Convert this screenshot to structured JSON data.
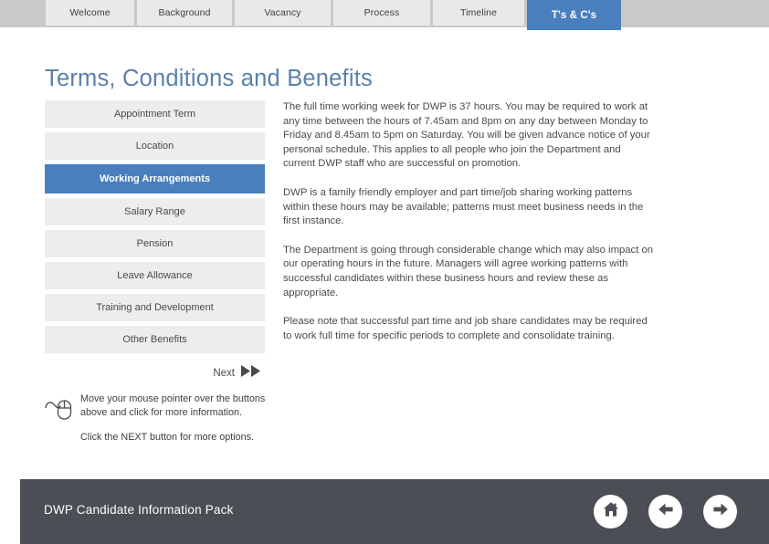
{
  "topbar": {
    "tabs": [
      {
        "label": "Welcome",
        "active": false
      },
      {
        "label": "Background",
        "active": false
      },
      {
        "label": "Vacancy",
        "active": false
      },
      {
        "label": "Process",
        "active": false
      },
      {
        "label": "Timeline",
        "active": false
      },
      {
        "label": "T's & C's",
        "active": true
      }
    ],
    "band_color": "#c9c9c9",
    "active_color": "#4a7fbd"
  },
  "page": {
    "title": "Terms, Conditions and Benefits",
    "title_color": "#5981ad"
  },
  "menu": {
    "items": [
      {
        "label": "Appointment Term",
        "selected": false
      },
      {
        "label": "Location",
        "selected": false
      },
      {
        "label": "Working Arrangements",
        "selected": true
      },
      {
        "label": "Salary Range",
        "selected": false
      },
      {
        "label": "Pension",
        "selected": false
      },
      {
        "label": "Leave Allowance",
        "selected": false
      },
      {
        "label": "Training and Development",
        "selected": false
      },
      {
        "label": "Other Benefits",
        "selected": false
      }
    ]
  },
  "content": {
    "paragraphs": [
      "The full time working week for DWP is 37 hours.  You may be required to work at any time between the hours of 7.45am and 8pm on any day between Monday to Friday and 8.45am to 5pm on Saturday. You will be given advance notice of your personal schedule. This applies to all people who join the Department and current DWP staff who are successful on promotion.",
      "DWP is a family friendly employer and part time/job sharing working patterns within these hours may be available; patterns must meet business needs in the first instance.",
      "The Department is going through considerable change which may also impact on our operating hours in the future. Managers will agree working patterns with successful candidates within these business hours and review these as appropriate.",
      "Please note that successful part time and job share candidates may be required to work full time for specific periods to complete and consolidate training."
    ]
  },
  "next": {
    "label": "Next",
    "icon": "double-chevron-right-icon"
  },
  "hint": {
    "icon": "mouse-icon",
    "line1": "Move your mouse pointer over the buttons above and click for more information.",
    "line2": "Click the NEXT button for more options."
  },
  "footer": {
    "title": "DWP Candidate Information Pack",
    "background": "#4b4e54",
    "nav": [
      {
        "name": "home-icon",
        "label": "Home"
      },
      {
        "name": "arrow-left-icon",
        "label": "Back"
      },
      {
        "name": "arrow-right-icon",
        "label": "Forward"
      }
    ]
  }
}
